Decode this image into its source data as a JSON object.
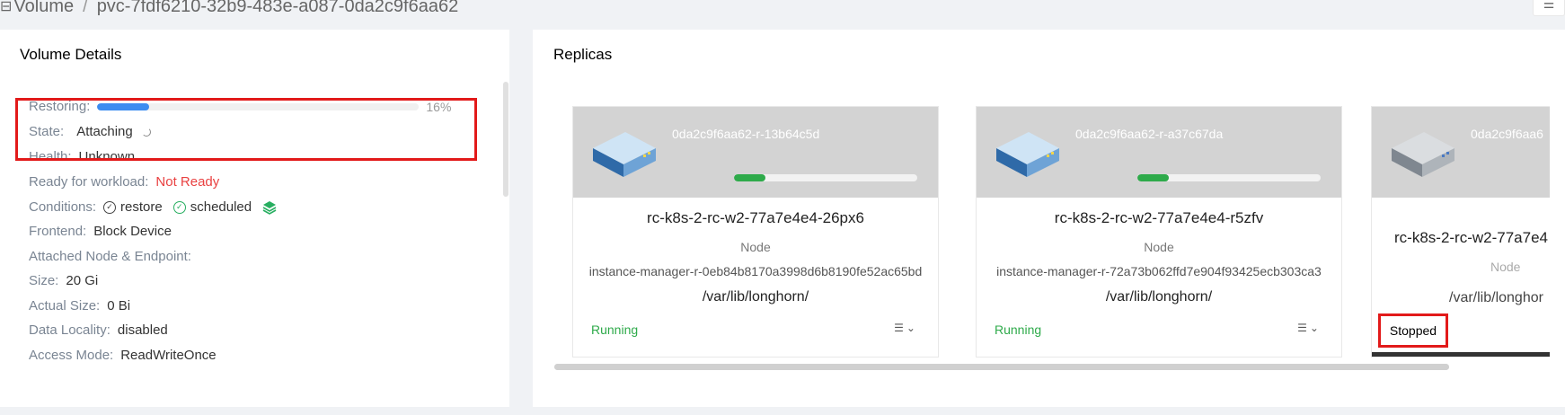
{
  "breadcrumb": {
    "icon": "database-icon",
    "root": "Volume",
    "separator": "/",
    "current": "pvc-7fdf6210-32b9-483e-a087-0da2c9f6aa62"
  },
  "top_right_icon": "list-icon",
  "volume_details": {
    "title": "Volume Details",
    "restoring_label": "Restoring:",
    "restoring_percent": 16,
    "restoring_percent_text": "16%",
    "state_label": "State:",
    "state_value": "Attaching",
    "health_label": "Health:",
    "health_value": "Unknown",
    "ready_label": "Ready for workload:",
    "ready_value": "Not Ready",
    "conditions_label": "Conditions:",
    "conditions": [
      {
        "name": "restore",
        "icon": "check-circle-icon",
        "color": "#444444"
      },
      {
        "name": "scheduled",
        "icon": "check-circle-icon",
        "color": "#27ae60"
      }
    ],
    "conditions_extra_icon": "layers-icon",
    "frontend_label": "Frontend:",
    "frontend_value": "Block Device",
    "attached_label": "Attached Node & Endpoint:",
    "size_label": "Size:",
    "size_value": "20 Gi",
    "actual_size_label": "Actual Size:",
    "actual_size_value": "0 Bi",
    "data_locality_label": "Data Locality:",
    "data_locality_value": "disabled",
    "access_mode_label": "Access Mode:",
    "access_mode_value": "ReadWriteOnce"
  },
  "replicas": {
    "title": "Replicas",
    "node_label": "Node",
    "items": [
      {
        "id": "0da2c9f6aa62-r-13b64c5d",
        "name": "rc-k8s-2-rc-w2-77a7e4e4-26px6",
        "node": "instance-manager-r-0eb84b8170a3998d6b8190fe52ac65bd",
        "path": "/var/lib/longhorn/",
        "status": "Running",
        "progress": 0.17
      },
      {
        "id": "0da2c9f6aa62-r-a37c67da",
        "name": "rc-k8s-2-rc-w2-77a7e4e4-r5zfv",
        "node": "instance-manager-r-72a73b062ffd7e904f93425ecb303ca3",
        "path": "/var/lib/longhorn/",
        "status": "Running",
        "progress": 0.17
      },
      {
        "id": "0da2c9f6aa6",
        "name": "rc-k8s-2-rc-w2-77a7e4",
        "path": "/var/lib/longhor",
        "status": "Stopped"
      }
    ]
  },
  "colors": {
    "accent_blue": "#3c8cf0",
    "running_green": "#2eaa4a",
    "not_ready_red": "#e94141",
    "highlight_red": "#e21a1a"
  }
}
